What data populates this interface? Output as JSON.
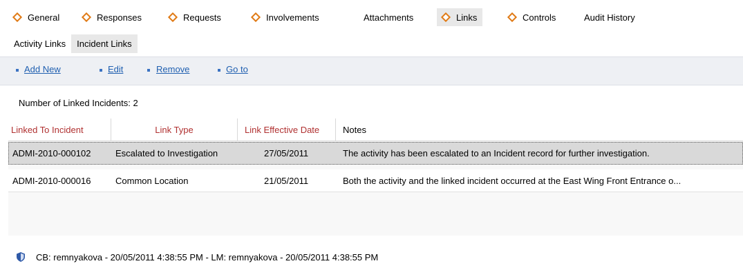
{
  "tabs": [
    {
      "label": "General",
      "has_icon": true
    },
    {
      "label": "Responses",
      "has_icon": true
    },
    {
      "label": "Requests",
      "has_icon": true
    },
    {
      "label": "Involvements",
      "has_icon": true
    },
    {
      "label": "Attachments",
      "has_icon": false
    },
    {
      "label": "Links",
      "has_icon": true,
      "active": true
    },
    {
      "label": "Controls",
      "has_icon": true
    },
    {
      "label": "Audit History",
      "has_icon": false
    }
  ],
  "subtabs": [
    {
      "label": "Activity Links"
    },
    {
      "label": "Incident Links",
      "active": true
    }
  ],
  "toolbar": {
    "add_new": "Add New",
    "edit": "Edit",
    "remove": "Remove",
    "go_to": "Go to"
  },
  "count_label": "Number of Linked Incidents: 2",
  "grid": {
    "columns": [
      "Linked To Incident",
      "Link Type",
      "Link Effective Date",
      "Notes"
    ],
    "rows": [
      {
        "incident": "ADMI-2010-000102",
        "link_type": "Escalated to Investigation",
        "date": "27/05/2011",
        "notes": "The activity has been escalated to an Incident record for further investigation.",
        "selected": true
      },
      {
        "incident": "ADMI-2010-000016",
        "link_type": "Common Location",
        "date": "21/05/2011",
        "notes": "Both the activity and the linked incident occurred at the East Wing Front Entrance o..."
      }
    ]
  },
  "footer": {
    "icon": "shield-icon",
    "text": "CB: remnyakova - 20/05/2011 4:38:55 PM - LM: remnyakova - 20/05/2011 4:38:55 PM"
  },
  "colors": {
    "tab_icon": "#e07b17",
    "header_red": "#b03030",
    "link_blue": "#1f5fb0",
    "toolbar_bg": "#eef0f4",
    "selected_row": "#d9d9d9"
  }
}
